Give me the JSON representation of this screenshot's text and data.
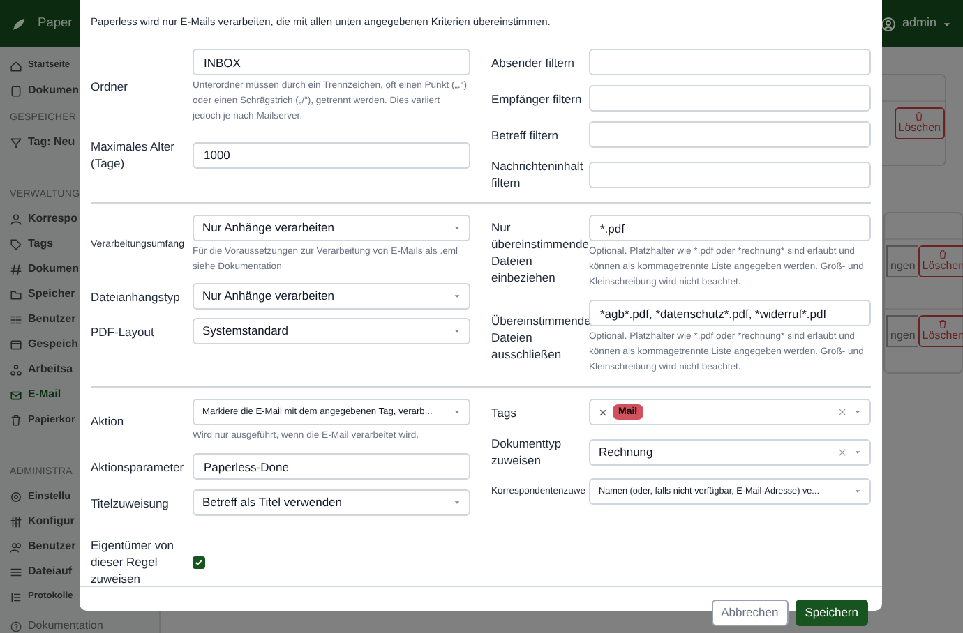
{
  "app": {
    "brand": "Paper",
    "user": "admin"
  },
  "sidebar": {
    "items": [
      {
        "kind": "item",
        "label": "Startseite",
        "selected": false
      },
      {
        "kind": "item",
        "label": "Dokumen",
        "selected": false
      },
      {
        "kind": "section",
        "label": "GESPEICHER"
      },
      {
        "kind": "item",
        "label": "Tag: Neu",
        "selected": false
      },
      {
        "kind": "section",
        "label": "VERWALTUNG"
      },
      {
        "kind": "item",
        "label": "Korrespo",
        "selected": false
      },
      {
        "kind": "item",
        "label": "Tags",
        "selected": false
      },
      {
        "kind": "item",
        "label": "Dokumen",
        "selected": false
      },
      {
        "kind": "item",
        "label": "Speicher",
        "selected": false
      },
      {
        "kind": "item",
        "label": "Benutzer",
        "selected": false
      },
      {
        "kind": "item",
        "label": "Gespeich",
        "selected": false
      },
      {
        "kind": "item",
        "label": "Arbeitsa",
        "selected": false
      },
      {
        "kind": "item",
        "label": "E-Mail",
        "selected": true
      },
      {
        "kind": "item",
        "label": "Papierkor",
        "selected": false
      },
      {
        "kind": "section",
        "label": "ADMINISTRA"
      },
      {
        "kind": "item",
        "label": "Einstellu",
        "selected": false
      },
      {
        "kind": "item",
        "label": "Konfigur",
        "selected": false
      },
      {
        "kind": "item",
        "label": "Benutzer",
        "selected": false
      },
      {
        "kind": "item",
        "label": "Dateiauf",
        "selected": false
      },
      {
        "kind": "item",
        "label": "Protokolle",
        "selected": false
      },
      {
        "kind": "footer",
        "label": "Dokumentation"
      }
    ]
  },
  "background_cards": [
    {
      "rows": [
        [
          "Löschen"
        ]
      ]
    },
    {
      "rows": [
        [
          "ngen",
          "Löschen"
        ],
        [
          "ngen",
          "Löschen"
        ]
      ]
    }
  ],
  "modal": {
    "intro": "Paperless wird nur E-Mails verarbeiten, die mit allen unten angegebenen Kriterien übereinstimmen.",
    "sections": [
      {
        "left": [
          {
            "kind": "text",
            "label": "Ordner",
            "value": "INBOX",
            "help": "Unterordner müssen durch ein Trennzeichen, oft einen Punkt („.“) oder einen Schrägstrich („/“), getrennt werden. Dies variiert jedoch je nach Mailserver."
          },
          {
            "kind": "text",
            "label": "Maximales Alter (Tage)",
            "value": "1000"
          }
        ],
        "right": [
          {
            "kind": "text",
            "label": "Absender filtern"
          },
          {
            "kind": "text",
            "label": "Empfänger filtern"
          },
          {
            "kind": "text",
            "label": "Betreff filtern"
          },
          {
            "kind": "text",
            "label": "Nachrichteninhalt filtern"
          }
        ]
      },
      {
        "left": [
          {
            "kind": "select",
            "label": "Verarbeitungsumfang",
            "value": "Nur Anhänge verarbeiten",
            "clearable": false,
            "wide_label": true,
            "help": "Für die Voraussetzungen zur Verarbeitung von E-Mails als .eml siehe Dokumentation"
          },
          {
            "kind": "select",
            "label": "Dateianhangstyp",
            "value": "Nur Anhänge verarbeiten",
            "clearable": false
          },
          {
            "kind": "select",
            "label": "PDF-Layout",
            "value": "Systemstandard",
            "clearable": false
          }
        ],
        "right": [
          {
            "kind": "text",
            "label": "Nur übereinstimmende Dateien einbeziehen",
            "value": "*.pdf",
            "help": "Optional. Platzhalter wie *.pdf oder *rechnung* sind erlaubt und können als kommagetrennte Liste angegeben werden. Groß- und Kleinschreibung wird nicht beachtet."
          },
          {
            "kind": "text",
            "label": "Übereinstimmende Dateien ausschließen",
            "value": "*agb*.pdf, *datenschutz*.pdf, *widerruf*.pdf",
            "help": "Optional. Platzhalter wie *.pdf oder *rechnung* sind erlaubt und können als kommagetrennte Liste angegeben werden. Groß- und Kleinschreibung wird nicht beachtet."
          }
        ]
      },
      {
        "left": [
          {
            "kind": "select",
            "label": "Aktion",
            "value": "Markiere die E-Mail mit dem angegebenen Tag, verarb...",
            "clearable": false,
            "help": "Wird nur ausgeführt, wenn die E-Mail verarbeitet wird."
          },
          {
            "kind": "text",
            "label": "Aktionsparameter",
            "value": "Paperless-Done"
          },
          {
            "kind": "select",
            "label": "Titelzuweisung",
            "value": "Betreff als Titel verwenden",
            "clearable": false
          },
          {
            "kind": "checkbox",
            "label": "Eigentümer von dieser Regel zuweisen",
            "checked": true
          }
        ],
        "right": [
          {
            "kind": "tags",
            "label": "Tags",
            "tags": [
              {
                "label": "Mail",
                "color": "#d0525e"
              }
            ],
            "clearable": true
          },
          {
            "kind": "select",
            "label": "Dokumenttyp zuweisen",
            "value": "Rechnung",
            "clearable": true
          },
          {
            "kind": "select",
            "label": "Korrespondentenzuwe",
            "value": "Namen (oder, falls nicht verfügbar, E-Mail-Adresse) ve...",
            "clearable": false,
            "wide_label": true
          }
        ]
      }
    ],
    "buttons": [
      {
        "kind": "secondary",
        "label": "Abbrechen"
      },
      {
        "kind": "primary",
        "label": "Speichern"
      }
    ]
  }
}
